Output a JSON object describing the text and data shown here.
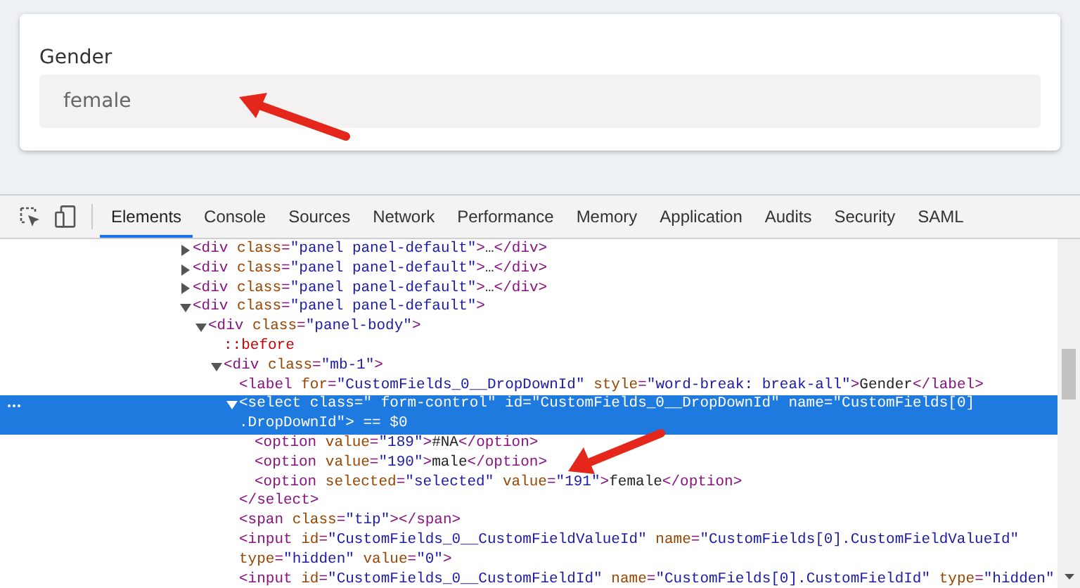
{
  "form": {
    "label": "Gender",
    "value": "female"
  },
  "devtools": {
    "tabs": [
      {
        "label": "Elements",
        "selected": true
      },
      {
        "label": "Console",
        "selected": false
      },
      {
        "label": "Sources",
        "selected": false
      },
      {
        "label": "Network",
        "selected": false
      },
      {
        "label": "Performance",
        "selected": false
      },
      {
        "label": "Memory",
        "selected": false
      },
      {
        "label": "Application",
        "selected": false
      },
      {
        "label": "Audits",
        "selected": false
      },
      {
        "label": "Security",
        "selected": false
      },
      {
        "label": "SAML",
        "selected": false
      }
    ],
    "tree": [
      {
        "kind": "collapsible",
        "expanded": false,
        "selected": false,
        "tokens": [
          {
            "kind": "tag",
            "text": "<div"
          },
          {
            "kind": "attr",
            "text": " class"
          },
          {
            "kind": "tag",
            "text": "="
          },
          {
            "kind": "value",
            "text": "\"panel panel-default\""
          },
          {
            "kind": "tag",
            "text": ">"
          },
          {
            "kind": "text",
            "text": "…"
          },
          {
            "kind": "tag",
            "text": "</div>"
          }
        ]
      },
      {
        "kind": "collapsible",
        "expanded": false,
        "selected": false,
        "tokens": [
          {
            "kind": "tag",
            "text": "<div"
          },
          {
            "kind": "attr",
            "text": " class"
          },
          {
            "kind": "tag",
            "text": "="
          },
          {
            "kind": "value",
            "text": "\"panel panel-default\""
          },
          {
            "kind": "tag",
            "text": ">"
          },
          {
            "kind": "text",
            "text": "…"
          },
          {
            "kind": "tag",
            "text": "</div>"
          }
        ]
      },
      {
        "kind": "collapsible",
        "expanded": false,
        "selected": false,
        "tokens": [
          {
            "kind": "tag",
            "text": "<div"
          },
          {
            "kind": "attr",
            "text": " class"
          },
          {
            "kind": "tag",
            "text": "="
          },
          {
            "kind": "value",
            "text": "\"panel panel-default\""
          },
          {
            "kind": "tag",
            "text": ">"
          },
          {
            "kind": "text",
            "text": "…"
          },
          {
            "kind": "tag",
            "text": "</div>"
          }
        ]
      },
      {
        "kind": "collapsible",
        "expanded": true,
        "selected": false,
        "tokens": [
          {
            "kind": "tag",
            "text": "<div"
          },
          {
            "kind": "attr",
            "text": " class"
          },
          {
            "kind": "tag",
            "text": "="
          },
          {
            "kind": "value",
            "text": "\"panel panel-default\""
          },
          {
            "kind": "tag",
            "text": ">"
          }
        ],
        "children": [
          {
            "kind": "collapsible",
            "expanded": true,
            "selected": false,
            "tokens": [
              {
                "kind": "tag",
                "text": "<div"
              },
              {
                "kind": "attr",
                "text": " class"
              },
              {
                "kind": "tag",
                "text": "="
              },
              {
                "kind": "value",
                "text": "\"panel-body\""
              },
              {
                "kind": "tag",
                "text": ">"
              }
            ],
            "children": [
              {
                "kind": "leaf",
                "selected": false,
                "tokens": [
                  {
                    "kind": "pseudo",
                    "text": "::before"
                  }
                ]
              },
              {
                "kind": "collapsible",
                "expanded": true,
                "selected": false,
                "tokens": [
                  {
                    "kind": "tag",
                    "text": "<div"
                  },
                  {
                    "kind": "attr",
                    "text": " class"
                  },
                  {
                    "kind": "tag",
                    "text": "="
                  },
                  {
                    "kind": "value",
                    "text": "\"mb-1\""
                  },
                  {
                    "kind": "tag",
                    "text": ">"
                  }
                ],
                "children": [
                  {
                    "kind": "leaf",
                    "selected": false,
                    "tokens": [
                      {
                        "kind": "tag",
                        "text": "<label"
                      },
                      {
                        "kind": "attr",
                        "text": " for"
                      },
                      {
                        "kind": "tag",
                        "text": "="
                      },
                      {
                        "kind": "value",
                        "text": "\"CustomFields_0__DropDownId\""
                      },
                      {
                        "kind": "attr",
                        "text": " style"
                      },
                      {
                        "kind": "tag",
                        "text": "="
                      },
                      {
                        "kind": "value",
                        "text": "\"word-break: break-all\""
                      },
                      {
                        "kind": "tag",
                        "text": ">"
                      },
                      {
                        "kind": "text",
                        "text": "Gender"
                      },
                      {
                        "kind": "tag",
                        "text": "</label>"
                      }
                    ]
                  },
                  {
                    "kind": "collapsible",
                    "expanded": true,
                    "selected": true,
                    "tokens": [
                      {
                        "kind": "tag",
                        "text": "<select"
                      },
                      {
                        "kind": "attr",
                        "text": " class"
                      },
                      {
                        "kind": "tag",
                        "text": "="
                      },
                      {
                        "kind": "value",
                        "text": "\" form-control\""
                      },
                      {
                        "kind": "attr",
                        "text": " id"
                      },
                      {
                        "kind": "tag",
                        "text": "="
                      },
                      {
                        "kind": "value",
                        "text": "\"CustomFields_0__DropDownId\""
                      },
                      {
                        "kind": "attr",
                        "text": " name"
                      },
                      {
                        "kind": "tag",
                        "text": "="
                      },
                      {
                        "kind": "value",
                        "text": "\"CustomFields[0]\n.DropDownId\""
                      },
                      {
                        "kind": "tag",
                        "text": ">"
                      },
                      {
                        "kind": "dim",
                        "text": " == $0"
                      }
                    ],
                    "children": [
                      {
                        "kind": "leaf",
                        "selected": false,
                        "tokens": [
                          {
                            "kind": "tag",
                            "text": "<option"
                          },
                          {
                            "kind": "attr",
                            "text": " value"
                          },
                          {
                            "kind": "tag",
                            "text": "="
                          },
                          {
                            "kind": "value",
                            "text": "\"189\""
                          },
                          {
                            "kind": "tag",
                            "text": ">"
                          },
                          {
                            "kind": "text",
                            "text": "#NA"
                          },
                          {
                            "kind": "tag",
                            "text": "</option>"
                          }
                        ]
                      },
                      {
                        "kind": "leaf",
                        "selected": false,
                        "tokens": [
                          {
                            "kind": "tag",
                            "text": "<option"
                          },
                          {
                            "kind": "attr",
                            "text": " value"
                          },
                          {
                            "kind": "tag",
                            "text": "="
                          },
                          {
                            "kind": "value",
                            "text": "\"190\""
                          },
                          {
                            "kind": "tag",
                            "text": ">"
                          },
                          {
                            "kind": "text",
                            "text": "male"
                          },
                          {
                            "kind": "tag",
                            "text": "</option>"
                          }
                        ]
                      },
                      {
                        "kind": "leaf",
                        "selected": false,
                        "tokens": [
                          {
                            "kind": "tag",
                            "text": "<option"
                          },
                          {
                            "kind": "attr",
                            "text": " selected"
                          },
                          {
                            "kind": "tag",
                            "text": "="
                          },
                          {
                            "kind": "value",
                            "text": "\"selected\""
                          },
                          {
                            "kind": "attr",
                            "text": " value"
                          },
                          {
                            "kind": "tag",
                            "text": "="
                          },
                          {
                            "kind": "value",
                            "text": "\"191\""
                          },
                          {
                            "kind": "tag",
                            "text": ">"
                          },
                          {
                            "kind": "text",
                            "text": "female"
                          },
                          {
                            "kind": "tag",
                            "text": "</option>"
                          }
                        ]
                      }
                    ]
                  },
                  {
                    "kind": "leaf",
                    "selected": false,
                    "tokens": [
                      {
                        "kind": "tag",
                        "text": "</select>"
                      }
                    ]
                  },
                  {
                    "kind": "leaf",
                    "selected": false,
                    "tokens": [
                      {
                        "kind": "tag",
                        "text": "<span"
                      },
                      {
                        "kind": "attr",
                        "text": " class"
                      },
                      {
                        "kind": "tag",
                        "text": "="
                      },
                      {
                        "kind": "value",
                        "text": "\"tip\""
                      },
                      {
                        "kind": "tag",
                        "text": ">"
                      },
                      {
                        "kind": "tag",
                        "text": "</span>"
                      }
                    ]
                  },
                  {
                    "kind": "leaf",
                    "selected": false,
                    "tokens": [
                      {
                        "kind": "tag",
                        "text": "<input"
                      },
                      {
                        "kind": "attr",
                        "text": " id"
                      },
                      {
                        "kind": "tag",
                        "text": "="
                      },
                      {
                        "kind": "value",
                        "text": "\"CustomFields_0__CustomFieldValueId\""
                      },
                      {
                        "kind": "attr",
                        "text": " name"
                      },
                      {
                        "kind": "tag",
                        "text": "="
                      },
                      {
                        "kind": "value",
                        "text": "\"CustomFields[0].CustomFieldValueId\""
                      },
                      {
                        "kind": "attr",
                        "text": "\ntype"
                      },
                      {
                        "kind": "tag",
                        "text": "="
                      },
                      {
                        "kind": "value",
                        "text": "\"hidden\""
                      },
                      {
                        "kind": "attr",
                        "text": " value"
                      },
                      {
                        "kind": "tag",
                        "text": "="
                      },
                      {
                        "kind": "value",
                        "text": "\"0\""
                      },
                      {
                        "kind": "tag",
                        "text": ">"
                      }
                    ]
                  },
                  {
                    "kind": "leaf",
                    "selected": false,
                    "tokens": [
                      {
                        "kind": "tag",
                        "text": "<input"
                      },
                      {
                        "kind": "attr",
                        "text": " id"
                      },
                      {
                        "kind": "tag",
                        "text": "="
                      },
                      {
                        "kind": "value",
                        "text": "\"CustomFields_0__CustomFieldId\""
                      },
                      {
                        "kind": "attr",
                        "text": " name"
                      },
                      {
                        "kind": "tag",
                        "text": "="
                      },
                      {
                        "kind": "value",
                        "text": "\"CustomFields[0].CustomFieldId\""
                      },
                      {
                        "kind": "attr",
                        "text": " type"
                      },
                      {
                        "kind": "tag",
                        "text": "="
                      },
                      {
                        "kind": "value",
                        "text": "\"hidden\""
                      }
                    ]
                  }
                ]
              }
            ]
          }
        ]
      }
    ]
  }
}
